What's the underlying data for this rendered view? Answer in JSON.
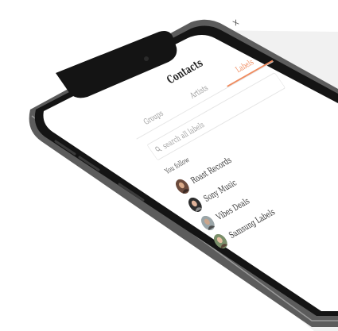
{
  "screen": {
    "close_glyph": "×",
    "title": "Contacts",
    "tabs": [
      {
        "label": "Groups",
        "active": false
      },
      {
        "label": "Artists",
        "active": false
      },
      {
        "label": "Labels",
        "active": true
      }
    ],
    "search": {
      "placeholder": "search all labels",
      "icon": "search-icon"
    },
    "section_label": "You follow",
    "contacts": [
      {
        "name": "Roast Records"
      },
      {
        "name": "Sony Music"
      },
      {
        "name": "Vibes Deals"
      },
      {
        "name": "Samsung Labels"
      }
    ]
  },
  "colors": {
    "accent": "#f08a5d",
    "phone_body": "#151515",
    "phone_edge": "#6e6e6e",
    "screen_bg": "#ffffff"
  }
}
